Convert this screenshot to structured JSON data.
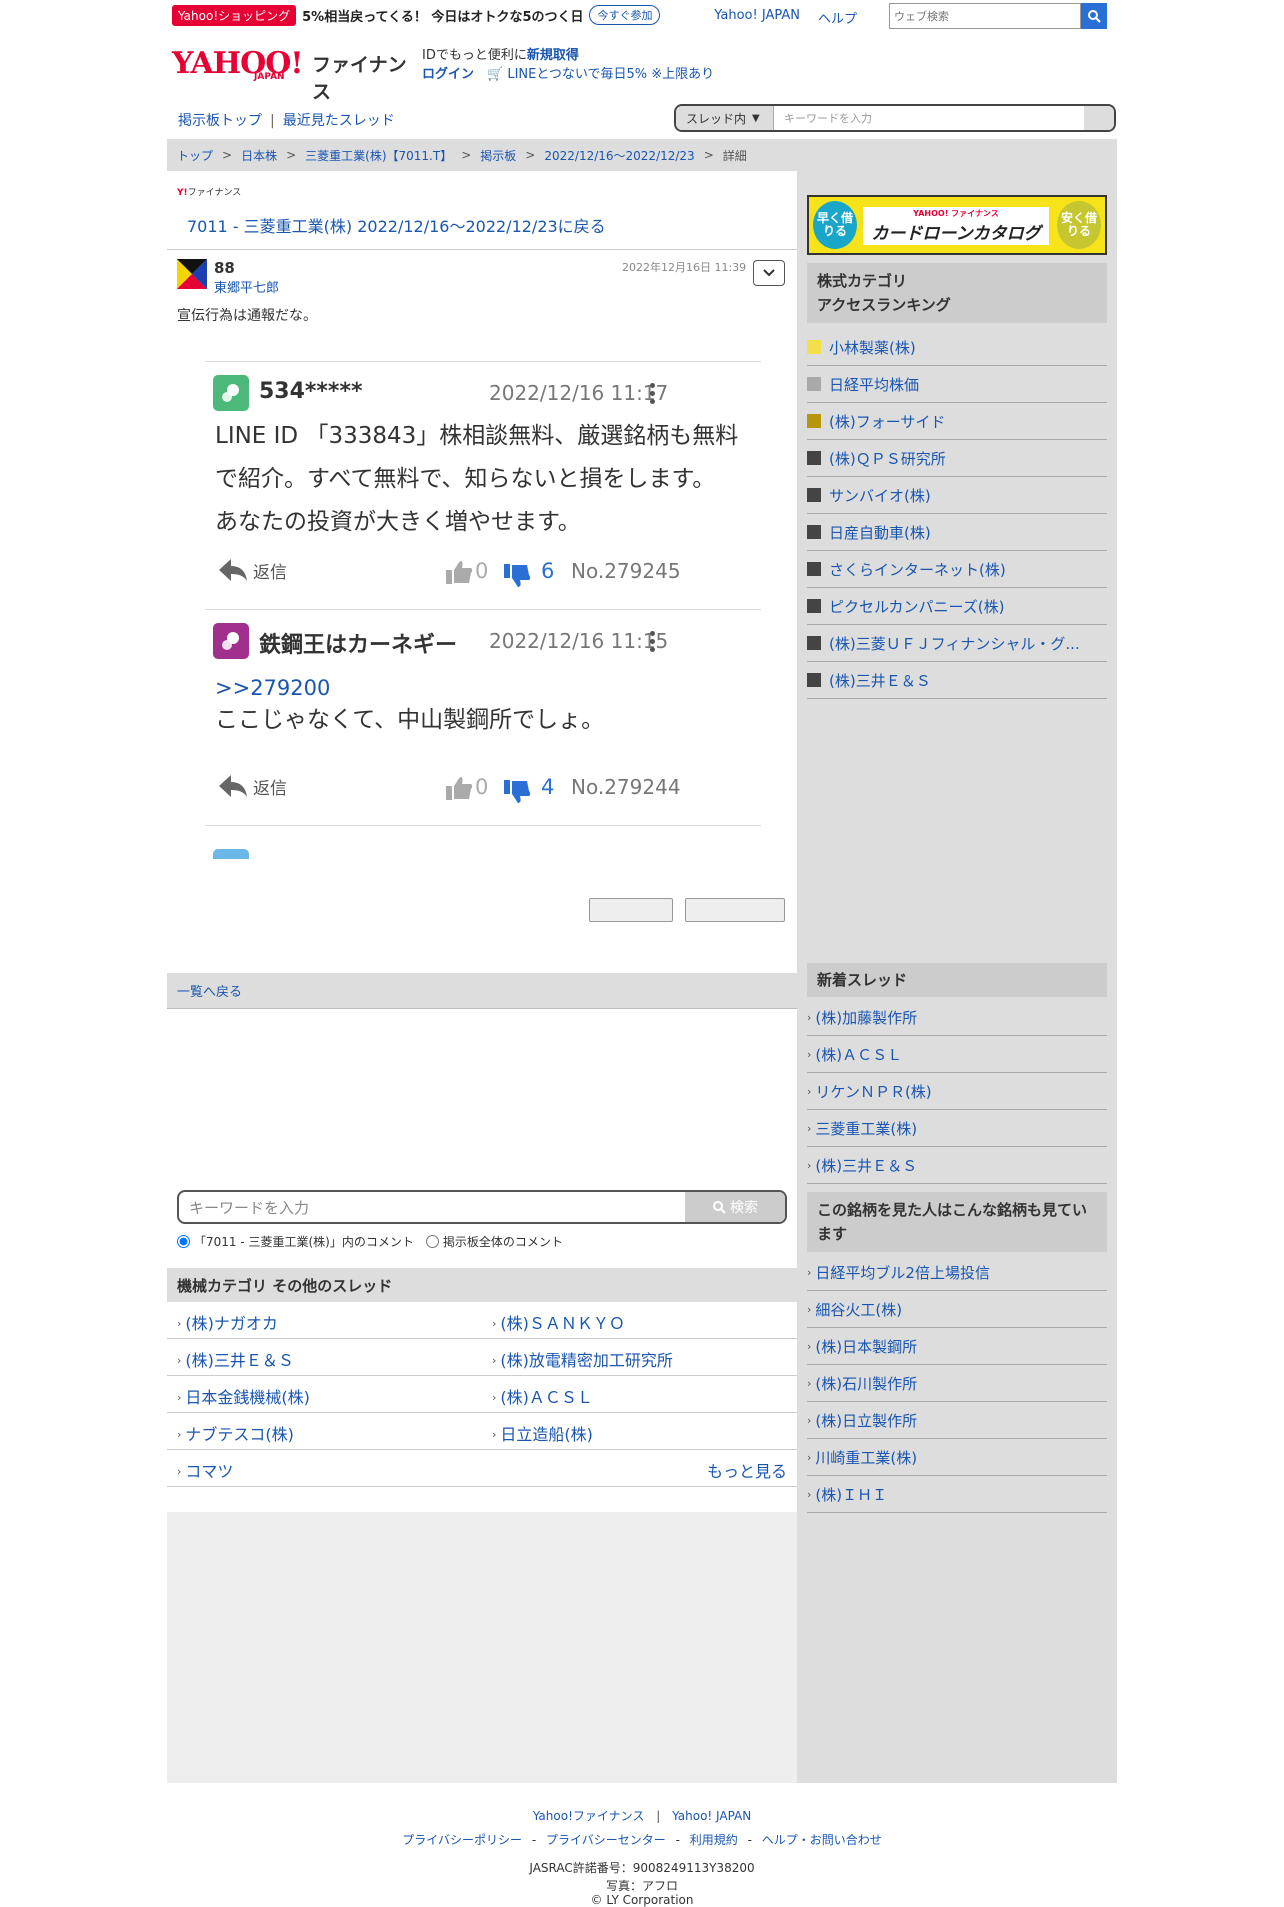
{
  "topbar": {
    "promo_tag": "Yahoo!ショッピング",
    "promo_text": "5%相当戻ってくる！ 今日はオトクな5のつく日",
    "promo_button": "今すぐ参加",
    "link_yahoo": "Yahoo! JAPAN",
    "link_help": "ヘルプ",
    "search_placeholder": "ウェブ検索"
  },
  "logo": {
    "brand": "YAHOO!",
    "sub": "JAPAN",
    "product": "ファイナンス"
  },
  "id_promo": {
    "line1_pre": "IDでもっと便利に",
    "line1_link": "新規取得",
    "login": "ログイン",
    "line2": "LINEとつないで毎日5% ※上限あり"
  },
  "bbnav": {
    "top": "掲示板トップ",
    "recent": "最近見たスレッド"
  },
  "thread_search": {
    "scope": "スレッド内",
    "placeholder": "キーワードを入力"
  },
  "breadcrumb": [
    "トップ",
    "日本株",
    "三菱重工業(株)【7011.T】",
    "掲示板",
    "2022/12/16〜2022/12/23",
    "詳細"
  ],
  "main": {
    "mini_logo": "ファイナンス",
    "back_link": "7011 - 三菱重工業(株) 2022/12/16〜2022/12/23に戻る",
    "post": {
      "number": "88",
      "user": "東郷平七郎",
      "date": "2022年12月16日 11:39",
      "text": "宣伝行為は通報だな。"
    },
    "embedded": {
      "comments": [
        {
          "name": "534*****",
          "date": "2022/12/16 11:17",
          "lines": [
            "LINE ID 「333843」株相談無料、厳選銘柄も無料",
            "で紹介。すべて無料で、知らないと損をします。",
            "あなたの投資が大きく増やせます。"
          ],
          "reply": "返信",
          "likes": "0",
          "dislikes": "6",
          "no": "No.279245"
        },
        {
          "name": "鉄鋼王はカーネギー",
          "date": "2022/12/16 11:15",
          "ref": ">>279200",
          "lines": [
            "ここじゃなくて、中山製鋼所でしょ。"
          ],
          "reply": "返信",
          "likes": "0",
          "dislikes": "4",
          "no": "No.279244"
        }
      ]
    },
    "list_back": "一覧へ戻る",
    "kw_search": {
      "placeholder": "キーワードを入力",
      "button": "検索"
    },
    "radio_thread": "「7011 - 三菱重工業(株)」内のコメント",
    "radio_all": "掲示板全体のコメント",
    "other_threads_title": "機械カテゴリ その他のスレッド",
    "other_threads": [
      [
        "(株)ナガオカ",
        "(株)ＳＡＮＫＹＯ"
      ],
      [
        "(株)三井Ｅ＆Ｓ",
        "(株)放電精密加工研究所"
      ],
      [
        "日本金銭機械(株)",
        "(株)ＡＣＳＬ"
      ],
      [
        "ナブテスコ(株)",
        "日立造船(株)"
      ]
    ],
    "other_last": "コマツ",
    "more": "もっと見る"
  },
  "sidebar": {
    "banner": {
      "left": "早く借りる",
      "top": "YAHOO! ファイナンス",
      "main": "カードローンカタログ",
      "right": "安く借りる"
    },
    "ranking_title_1": "株式カテゴリ",
    "ranking_title_2": "アクセスランキング",
    "ranking": [
      {
        "name": "小林製薬(株)",
        "color": "#f2df4a"
      },
      {
        "name": "日経平均株価",
        "color": "#aaaaaa"
      },
      {
        "name": "(株)フォーサイド",
        "color": "#b8960c"
      },
      {
        "name": "(株)ＱＰＳ研究所",
        "color": "#444444"
      },
      {
        "name": "サンバイオ(株)",
        "color": "#444444"
      },
      {
        "name": "日産自動車(株)",
        "color": "#444444"
      },
      {
        "name": "さくらインターネット(株)",
        "color": "#444444"
      },
      {
        "name": "ピクセルカンパニーズ(株)",
        "color": "#444444"
      },
      {
        "name": "(株)三菱ＵＦＪフィナンシャル・グ...",
        "color": "#444444"
      },
      {
        "name": "(株)三井Ｅ＆Ｓ",
        "color": "#444444"
      }
    ],
    "new_threads_title": "新着スレッド",
    "new_threads": [
      "(株)加藤製作所",
      "(株)ＡＣＳＬ",
      "リケンＮＰＲ(株)",
      "三菱重工業(株)",
      "(株)三井Ｅ＆Ｓ"
    ],
    "also_viewed_title": "この銘柄を見た人はこんな銘柄も見ています",
    "also_viewed": [
      "日経平均ブル2倍上場投信",
      "細谷火工(株)",
      "(株)日本製鋼所",
      "(株)石川製作所",
      "(株)日立製作所",
      "川崎重工業(株)",
      "(株)ＩＨＩ"
    ]
  },
  "footer": {
    "link1": "Yahoo!ファイナンス",
    "link2": "Yahoo! JAPAN",
    "privacy": "プライバシーポリシー",
    "privacy_center": "プライバシーセンター",
    "terms": "利用規約",
    "help": "ヘルプ・お問い合わせ",
    "jasrac": "JASRAC許諾番号：9008249113Y38200",
    "photo": "写真：アフロ",
    "copyright": "© LY Corporation"
  },
  "colors": {
    "accent": "#1a56b0",
    "brand": "#e60033"
  }
}
